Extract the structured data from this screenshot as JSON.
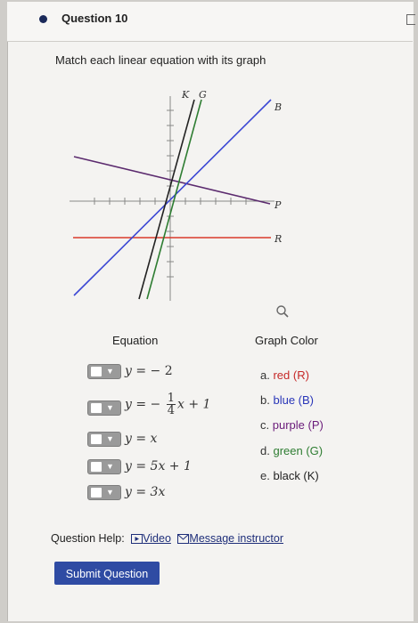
{
  "question": {
    "title": "Question 10",
    "instruction": "Match each linear equation with its graph"
  },
  "graph": {
    "labels": {
      "k": "K",
      "g": "G",
      "b": "B",
      "p": "P",
      "r": "R"
    },
    "colors": {
      "red": "#d93a2b",
      "blue": "#3b47d4",
      "purple": "#5b2a6e",
      "green": "#2e7d32",
      "black": "#222222"
    }
  },
  "columns": {
    "equation": "Equation",
    "graph_color": "Graph Color"
  },
  "equations": [
    {
      "lhs": "y =",
      "rhs": "− 2"
    },
    {
      "lhs": "y =",
      "sign": "−",
      "num": "1",
      "den": "4",
      "tail": "x + 1"
    },
    {
      "lhs": "y =",
      "rhs": "x"
    },
    {
      "lhs": "y =",
      "rhs": "5x + 1"
    },
    {
      "lhs": "y =",
      "rhs": "3x"
    }
  ],
  "options": [
    {
      "letter": "a.",
      "text": "red (R)",
      "color": "#c62828"
    },
    {
      "letter": "b.",
      "text": "blue (B)",
      "color": "#2835b8"
    },
    {
      "letter": "c.",
      "text": "purple (P)",
      "color": "#6a1b7a"
    },
    {
      "letter": "d.",
      "text": "green (G)",
      "color": "#2e7d32"
    },
    {
      "letter": "e.",
      "text": "black (K)",
      "color": "#222222"
    }
  ],
  "help": {
    "label": "Question Help:",
    "video": "Video",
    "message": "Message instructor"
  },
  "submit": "Submit Question",
  "icons": {
    "select_arrow": "▼",
    "zoom": "magnifier-icon",
    "video": "video-icon",
    "message": "mail-icon"
  }
}
